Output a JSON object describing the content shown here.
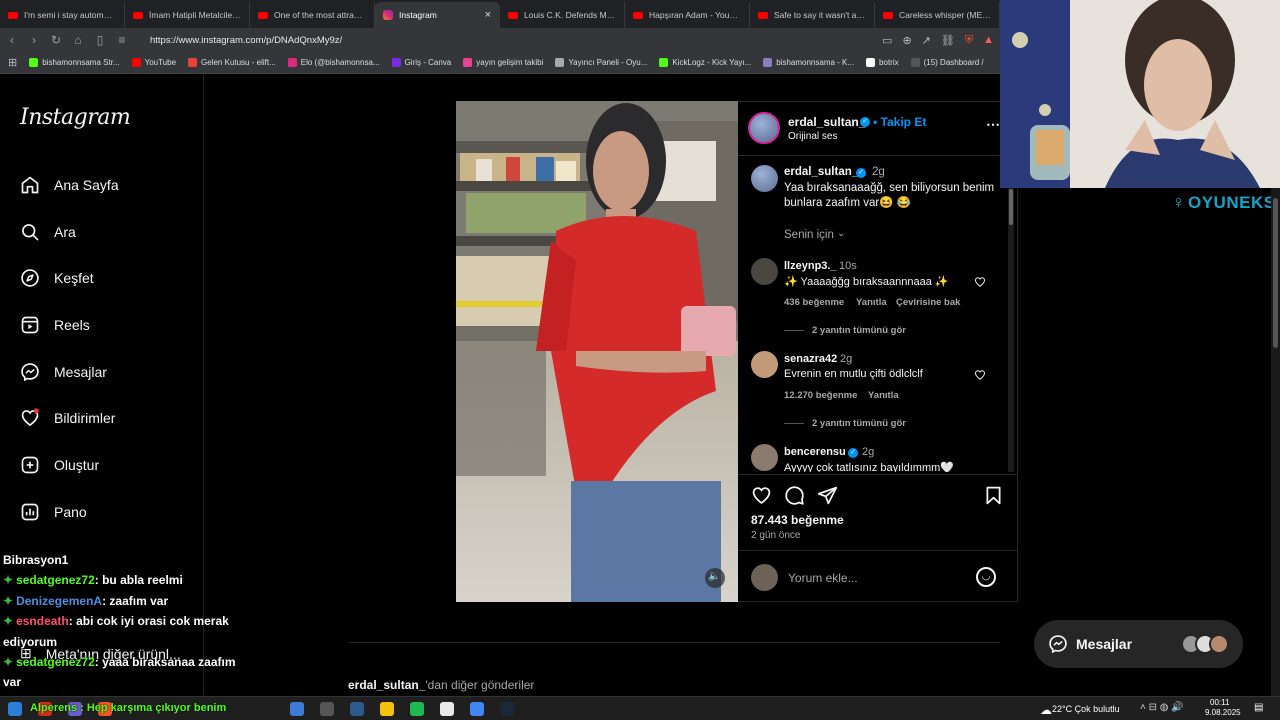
{
  "browser": {
    "tabs": [
      {
        "label": "I'm semi i stay automatic,",
        "icon": "youtube",
        "active": false
      },
      {
        "label": "İmam Hatipli Metalciler VS",
        "icon": "youtube",
        "active": false
      },
      {
        "label": "One of the most attractive",
        "icon": "youtube",
        "active": false
      },
      {
        "label": "Instagram",
        "icon": "instagram",
        "active": true
      },
      {
        "label": "Louis C.K. Defends Mastur",
        "icon": "youtube",
        "active": false
      },
      {
        "label": "Hapşıran Adam - YouTube",
        "icon": "youtube",
        "active": false
      },
      {
        "label": "Safe to say it wasn't a cut",
        "icon": "youtube",
        "active": false
      },
      {
        "label": "Careless whisper (MEOW",
        "icon": "youtube",
        "active": false
      }
    ],
    "url": "https://www.instagram.com/p/DNAdQnxMy9z/",
    "bookmarks": [
      {
        "label": "bishamonnsama Str...",
        "color": "#53fc18"
      },
      {
        "label": "YouTube",
        "color": "#ff0000"
      },
      {
        "label": "Gelen Kutusu - elift...",
        "color": "#ea4335"
      },
      {
        "label": "Elo (@bishamonnsa...",
        "color": "#dd2a7b"
      },
      {
        "label": "Giriş - Canva",
        "color": "#7d2ae8"
      },
      {
        "label": "yayın gelişim takibi",
        "color": "#e84393"
      },
      {
        "label": "Yayıncı Paneli - Oyu...",
        "color": "#aaaaaa"
      },
      {
        "label": "KickLogz - Kick Yayı...",
        "color": "#53fc18"
      },
      {
        "label": "bishamonnsama - K...",
        "color": "#8e7cc3"
      },
      {
        "label": "botrix",
        "color": "#ffffff"
      },
      {
        "label": "(15) Dashboard /",
        "color": "#555555"
      }
    ]
  },
  "instagram": {
    "logo": "Instagram",
    "nav": [
      {
        "label": "Ana Sayfa",
        "icon": "home-icon"
      },
      {
        "label": "Ara",
        "icon": "search-icon"
      },
      {
        "label": "Keşfet",
        "icon": "compass-icon"
      },
      {
        "label": "Reels",
        "icon": "reels-icon"
      },
      {
        "label": "Mesajlar",
        "icon": "messenger-icon"
      },
      {
        "label": "Bildirimler",
        "icon": "heart-icon"
      },
      {
        "label": "Oluştur",
        "icon": "plus-icon"
      },
      {
        "label": "Pano",
        "icon": "dashboard-icon"
      }
    ],
    "more_from_meta": "Meta'nın diğer ürünl...",
    "post": {
      "username": "erdal_sultan_",
      "follow": "• Takip Et",
      "audio": "Orijinal ses",
      "caption_time": "2g",
      "caption": "Yaa bıraksanaaağğ, sen biliyorsun benim bunlara zaafım var😆 😂",
      "for_you": "Senin için",
      "comments": [
        {
          "user": "llzeynp3._",
          "time": "10s",
          "text": "✨ Yaaaağğg bıraksaannnaaa ✨",
          "likes": "436 beğenme",
          "reply": "Yanıtla",
          "translate": "Çevirisine bak",
          "replies": "2 yanıtın tümünü gör"
        },
        {
          "user": "senazra42",
          "time": "2g",
          "text": "Evrenin en mutlu çifti ödlclclf",
          "likes": "12.270 beğenme",
          "reply": "Yanıtla",
          "replies": "2 yanıtın tümünü gör"
        },
        {
          "user": "bencerensu",
          "time": "2g",
          "text": "Ayyyy çok tatlısınız bayıldımmm🤍"
        }
      ],
      "like_count": "87.443 beğenme",
      "posted": "2 gün önce",
      "comment_placeholder": "Yorum ekle...",
      "more_posts_user": "erdal_sultan_",
      "more_posts_suffix": "'dan diğer gönderiler"
    },
    "messages_pill": "Mesajlar"
  },
  "overlay": {
    "brand": "OYUNEKS",
    "chat": [
      {
        "user": "Bibrasyon1",
        "text": "",
        "color": "#ffffff"
      },
      {
        "user": "sedatgenez72",
        "text": ": bu abla reelmi",
        "color": "#53fc18"
      },
      {
        "user": "DenizegemenA",
        "text": ": zaafım var",
        "color": "#4a90e2"
      },
      {
        "user": "esndeath",
        "text": ": abi cok iyi orasi cok merak ediyorum",
        "color": "#ff4d6d"
      },
      {
        "user": "sedatgenez72",
        "text": ": yaaa bıraksanaa zaafım var",
        "color": "#53fc18"
      }
    ],
    "alert": "Alperens : Hep karşıma çıkıyor benim"
  },
  "taskbar": {
    "weather": "22°C  Çok bulutlu",
    "time": "00:11",
    "date": "9.08.2025"
  }
}
